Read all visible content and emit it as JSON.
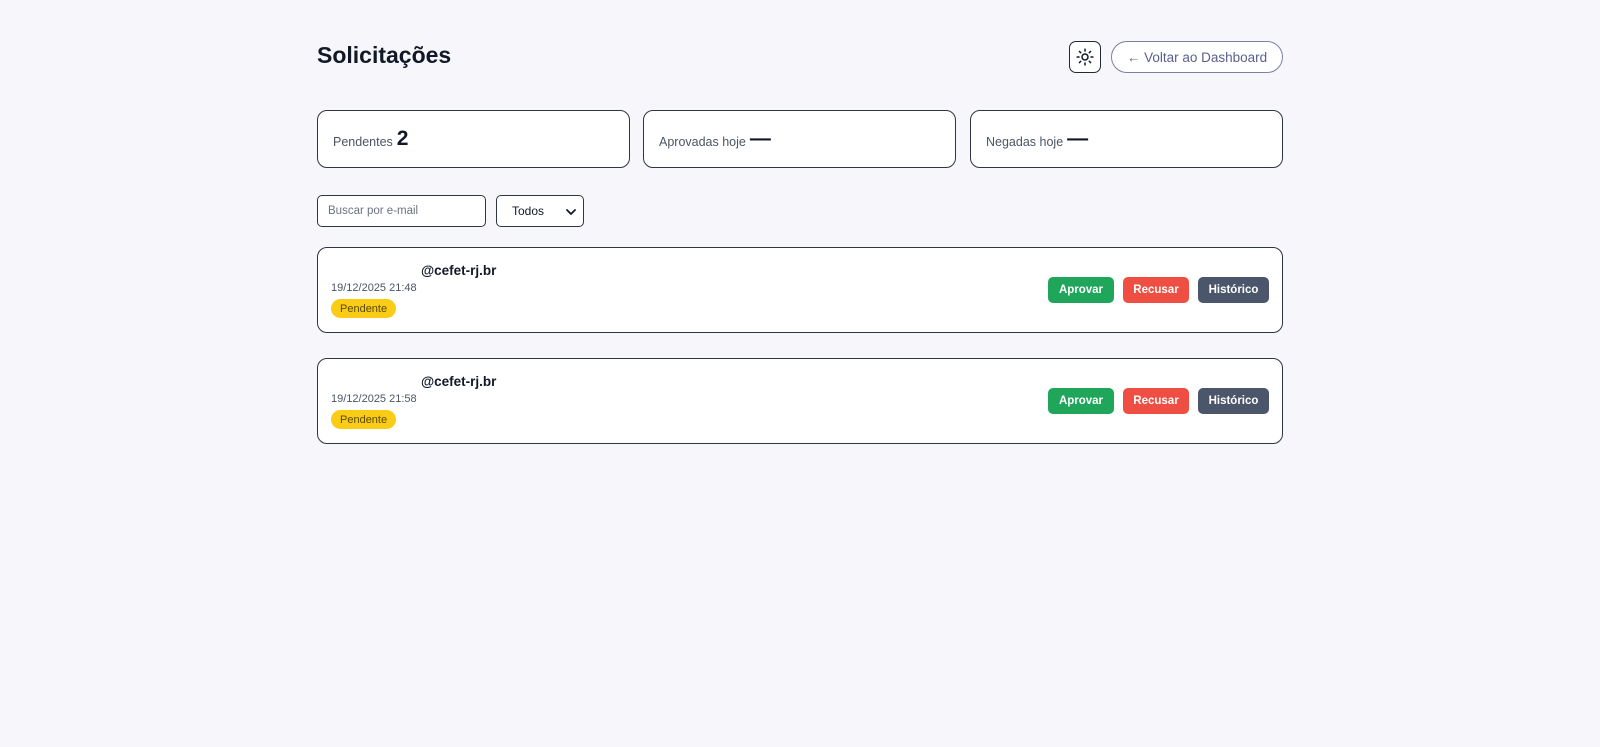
{
  "header": {
    "title": "Solicitações",
    "theme_toggle_icon": "sun-icon",
    "back_label": "← Voltar ao Dashboard"
  },
  "stats": [
    {
      "label": "Pendentes",
      "value": "2"
    },
    {
      "label": "Aprovadas hoje",
      "value": "—"
    },
    {
      "label": "Negadas hoje",
      "value": "—"
    }
  ],
  "filters": {
    "search_placeholder": "Buscar por e-mail",
    "search_value": "",
    "status_selected": "Todos"
  },
  "requests": [
    {
      "email": "@cefet-rj.br",
      "date": "19/12/2025 21:48",
      "status": "Pendente",
      "approve_label": "Aprovar",
      "reject_label": "Recusar",
      "history_label": "Histórico"
    },
    {
      "email": "@cefet-rj.br",
      "date": "19/12/2025 21:58",
      "status": "Pendente",
      "approve_label": "Aprovar",
      "reject_label": "Recusar",
      "history_label": "Histórico"
    }
  ],
  "colors": {
    "background": "#f7f7fb",
    "approve": "#1fa65a",
    "reject": "#ef4f42",
    "history": "#4b566b",
    "pending_badge": "#facc15"
  }
}
